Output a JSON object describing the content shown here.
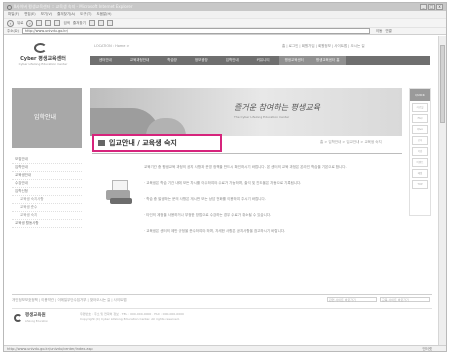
{
  "window": {
    "title": "Ⅱ사이버 평생교육센터 :: 교육생 숙지 - Microsoft Internet Explorer",
    "controls": [
      "_",
      "□",
      "x"
    ]
  },
  "menubar": [
    "파일(F)",
    "편집(E)",
    "보기(V)",
    "즐겨찾기(A)",
    "도구(T)",
    "도움말(H)"
  ],
  "toolbar": {
    "back": "뒤로",
    "search": "검색",
    "favorites": "즐겨찾기"
  },
  "address": {
    "label": "주소(D)",
    "url": "http://www.univdu.go.kr/",
    "go": "이동",
    "links": "연결"
  },
  "site": {
    "logo_name": "Cyber 평생교육센터",
    "logo_sub": "Cyber Lifelong Education Center",
    "location": "LOCATION : Home >",
    "util_links": "홈 | 로그인 | 회원가입 | 회원정보 | 사이트맵 | 오시는 길",
    "gnb": [
      "센터안내",
      "교육과정안내",
      "학습방",
      "정보광장",
      "입학안내",
      "커뮤니티",
      "평생교육센터",
      "평생교육센터 홈"
    ],
    "lnb_head": "입학안내",
    "lnb_items": [
      "모집안내",
      "입학안내",
      "교육생안내",
      "수강안내",
      "입학신청"
    ],
    "lnb_sub": [
      "교육생 숙지사항",
      "교육생 준수",
      "교육생 숙지"
    ],
    "lnb_last": "교육생 활동사항",
    "banner_slogan": "즐거운 참여하는 평생교육",
    "banner_slogan2": "The Cyber Lifelong Education Center",
    "quick_head": "QUICK",
    "quick_items": [
      "자료실",
      "FAQ",
      "Q&A",
      "공지",
      "학습",
      "이벤트",
      "메일",
      "TOP"
    ],
    "page_title": "입교안내 / 교육생 숙지",
    "breadcrumb": "홈 > 입학안내 > 입교안내 > 교육생 숙지",
    "paragraphs": [
      "교육기간 중 평생교육 과정의 공지 사항과 운영 정책을 반드시 확인하시기 바랍니다. 본 센터의 교육 과정은 온라인 학습을 기본으로 합니다.",
      "· 교육생은 학습 기간 내에 모든 차시를 이수하여야 수료가 가능하며, 출석 및 진도율은 자동으로 기록됩니다.",
      "· 학습 중 발생하는 문의 사항은 게시판 또는 상담 전화를 이용하여 주시기 바랍니다.",
      "· 타인의 계정을 사용하거나 부정한 방법으로 수강하는 경우 수료가 취소될 수 있습니다.",
      "· 교육생은 센터의 제반 규정을 준수하여야 하며, 자세한 사항은 공지사항을 참고하시기 바랍니다."
    ],
    "footer_links": "개인정보보호정책 | 이용약관 | 이메일무단수집거부 | 찾아오시는 길 | 사이트맵",
    "footer_selects": [
      "관련 사이트 바로가기",
      "교육 사이트 바로가기"
    ],
    "footer_logo_name": "평생교육원",
    "footer_logo_sub": "Lifelong Education",
    "copyright_1": "우편번호 : 주소 및 연락처 정보 · TEL : 000-000-0000 · FAX : 000-000-0000",
    "copyright_2": "Copyright (C) Cyber Lifelong Education Center. All rights reserved."
  },
  "status": {
    "url": "http://www.univdu.go.kr/univdu/center/index.asp",
    "zone": "인터넷"
  }
}
